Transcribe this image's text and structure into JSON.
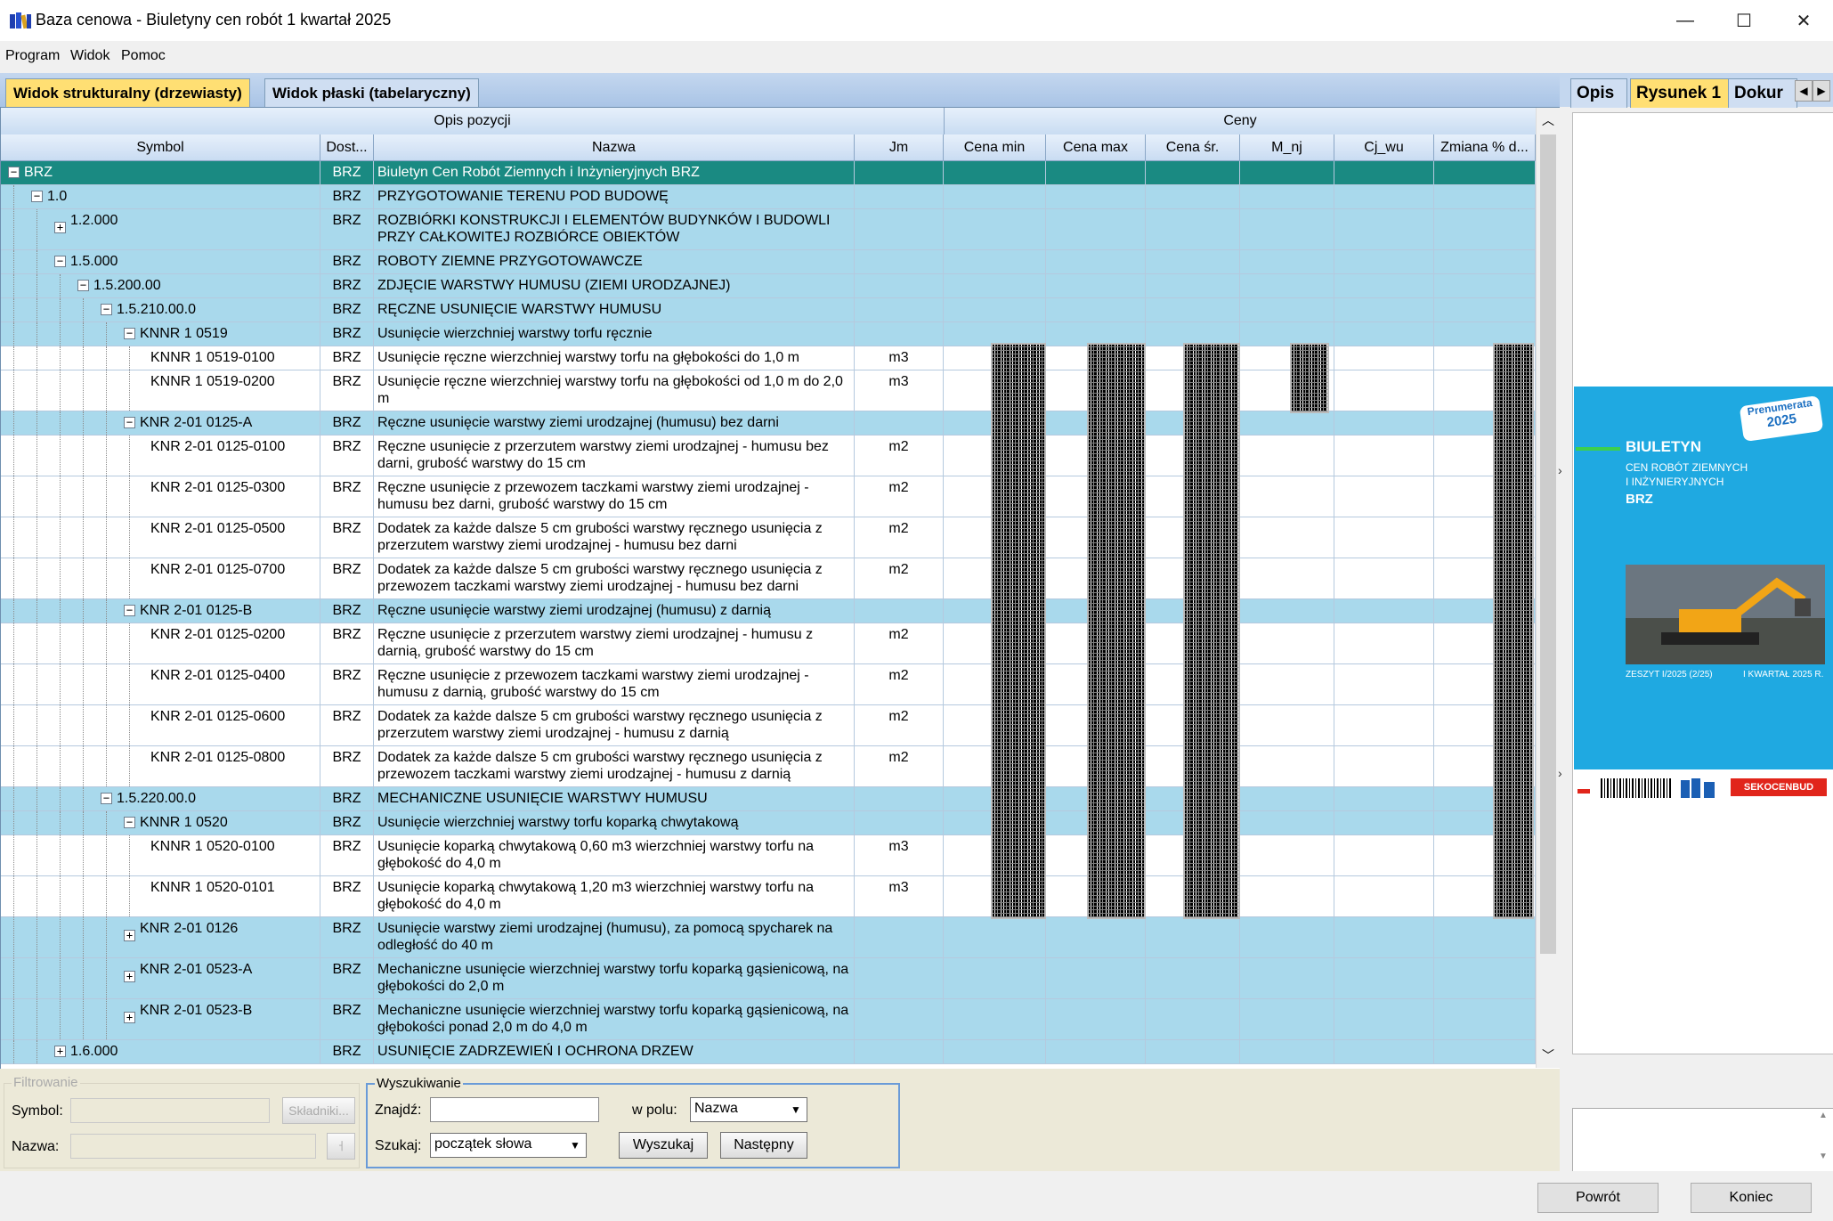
{
  "window": {
    "title": "Baza cenowa - Biuletyny cen robót 1 kwartał 2025",
    "minimize": "—",
    "maximize": "☐",
    "close": "✕"
  },
  "menu": [
    "Program",
    "Widok",
    "Pomoc"
  ],
  "tabs": [
    "Widok strukturalny (drzewiasty)",
    "Widok płaski (tabelaryczny)"
  ],
  "bands": {
    "left": "Opis pozycji",
    "right": "Ceny"
  },
  "columns": [
    "Symbol",
    "Dost...",
    "Nazwa",
    "Jm",
    "Cena min",
    "Cena max",
    "Cena śr.",
    "M_nj",
    "Cj_wu",
    "Zmiana % d..."
  ],
  "rows": [
    {
      "symbol": "BRZ",
      "dost": "BRZ",
      "nazwa": "Biuletyn Cen Robót Ziemnych i Inżynieryjnych BRZ",
      "jm": "",
      "level": 0,
      "type": "sel",
      "exp": "−",
      "h": 27
    },
    {
      "symbol": "1.0",
      "dost": "BRZ",
      "nazwa": "PRZYGOTOWANIE TERENU POD BUDOWĘ",
      "jm": "",
      "level": 1,
      "type": "group",
      "exp": "−",
      "h": 27
    },
    {
      "symbol": "1.2.000",
      "dost": "BRZ",
      "nazwa": "ROZBIÓRKI KONSTRUKCJI I ELEMENTÓW BUDYNKÓW I BUDOWLI PRZY CAŁKOWITEJ ROZBIÓRCE OBIEKTÓW",
      "jm": "",
      "level": 2,
      "type": "group",
      "exp": "+",
      "h": 46
    },
    {
      "symbol": "1.5.000",
      "dost": "BRZ",
      "nazwa": "ROBOTY ZIEMNE PRZYGOTOWAWCZE",
      "jm": "",
      "level": 2,
      "type": "group",
      "exp": "−",
      "h": 27
    },
    {
      "symbol": "1.5.200.00",
      "dost": "BRZ",
      "nazwa": "ZDJĘCIE WARSTWY HUMUSU (ZIEMI URODZAJNEJ)",
      "jm": "",
      "level": 3,
      "type": "group",
      "exp": "−",
      "h": 27
    },
    {
      "symbol": "1.5.210.00.0",
      "dost": "BRZ",
      "nazwa": "RĘCZNE USUNIĘCIE WARSTWY HUMUSU",
      "jm": "",
      "level": 4,
      "type": "group",
      "exp": "−",
      "h": 27
    },
    {
      "symbol": "KNNR 1 0519",
      "dost": "BRZ",
      "nazwa": "Usunięcie wierzchniej warstwy torfu ręcznie",
      "jm": "",
      "level": 5,
      "type": "group",
      "exp": "−",
      "h": 27
    },
    {
      "symbol": "KNNR 1 0519-0100",
      "dost": "BRZ",
      "nazwa": "Usunięcie ręczne wierzchniej warstwy torfu na głębokości do 1,0 m",
      "jm": "m3",
      "level": 6,
      "type": "leaf",
      "exp": "",
      "h": 27
    },
    {
      "symbol": "KNNR 1 0519-0200",
      "dost": "BRZ",
      "nazwa": "Usunięcie ręczne wierzchniej warstwy torfu na głębokości od 1,0 m do 2,0 m",
      "jm": "m3",
      "level": 6,
      "type": "leaf",
      "exp": "",
      "h": 46
    },
    {
      "symbol": "KNR 2-01 0125-A",
      "dost": "BRZ",
      "nazwa": "Ręczne usunięcie warstwy ziemi urodzajnej (humusu) bez darni",
      "jm": "",
      "level": 5,
      "type": "group",
      "exp": "−",
      "h": 27
    },
    {
      "symbol": "KNR 2-01 0125-0100",
      "dost": "BRZ",
      "nazwa": "Ręczne usunięcie z przerzutem warstwy ziemi urodzajnej - humusu bez darni, grubość warstwy do 15 cm",
      "jm": "m2",
      "level": 6,
      "type": "leaf",
      "exp": "",
      "h": 46
    },
    {
      "symbol": "KNR 2-01 0125-0300",
      "dost": "BRZ",
      "nazwa": "Ręczne usunięcie z przewozem taczkami warstwy ziemi urodzajnej - humusu bez darni, grubość warstwy do 15 cm",
      "jm": "m2",
      "level": 6,
      "type": "leaf",
      "exp": "",
      "h": 46
    },
    {
      "symbol": "KNR 2-01 0125-0500",
      "dost": "BRZ",
      "nazwa": "Dodatek za każde dalsze 5 cm grubości warstwy ręcznego usunięcia z przerzutem warstwy ziemi urodzajnej - humusu bez darni",
      "jm": "m2",
      "level": 6,
      "type": "leaf",
      "exp": "",
      "h": 46
    },
    {
      "symbol": "KNR 2-01 0125-0700",
      "dost": "BRZ",
      "nazwa": "Dodatek za każde dalsze 5 cm grubości warstwy ręcznego usunięcia z przewozem taczkami warstwy ziemi urodzajnej - humusu bez darni",
      "jm": "m2",
      "level": 6,
      "type": "leaf",
      "exp": "",
      "h": 46
    },
    {
      "symbol": "KNR 2-01 0125-B",
      "dost": "BRZ",
      "nazwa": "Ręczne usunięcie warstwy ziemi urodzajnej (humusu) z darnią",
      "jm": "",
      "level": 5,
      "type": "group",
      "exp": "−",
      "h": 27
    },
    {
      "symbol": "KNR 2-01 0125-0200",
      "dost": "BRZ",
      "nazwa": "Ręczne usunięcie z przerzutem warstwy ziemi urodzajnej - humusu z darnią, grubość warstwy do 15 cm",
      "jm": "m2",
      "level": 6,
      "type": "leaf",
      "exp": "",
      "h": 46
    },
    {
      "symbol": "KNR 2-01 0125-0400",
      "dost": "BRZ",
      "nazwa": "Ręczne usunięcie z przewozem taczkami warstwy ziemi urodzajnej - humusu z darnią, grubość warstwy do 15 cm",
      "jm": "m2",
      "level": 6,
      "type": "leaf",
      "exp": "",
      "h": 46
    },
    {
      "symbol": "KNR 2-01 0125-0600",
      "dost": "BRZ",
      "nazwa": "Dodatek za każde dalsze 5 cm grubości warstwy ręcznego usunięcia z przerzutem warstwy ziemi urodzajnej - humusu z darnią",
      "jm": "m2",
      "level": 6,
      "type": "leaf",
      "exp": "",
      "h": 46
    },
    {
      "symbol": "KNR 2-01 0125-0800",
      "dost": "BRZ",
      "nazwa": "Dodatek za każde dalsze 5 cm grubości warstwy ręcznego usunięcia z przewozem taczkami warstwy ziemi urodzajnej - humusu z darnią",
      "jm": "m2",
      "level": 6,
      "type": "leaf",
      "exp": "",
      "h": 46
    },
    {
      "symbol": "1.5.220.00.0",
      "dost": "BRZ",
      "nazwa": "MECHANICZNE USUNIĘCIE WARSTWY HUMUSU",
      "jm": "",
      "level": 4,
      "type": "group",
      "exp": "−",
      "h": 27
    },
    {
      "symbol": "KNNR 1 0520",
      "dost": "BRZ",
      "nazwa": "Usunięcie wierzchniej warstwy torfu koparką chwytakową",
      "jm": "",
      "level": 5,
      "type": "group",
      "exp": "−",
      "h": 27
    },
    {
      "symbol": "KNNR 1 0520-0100",
      "dost": "BRZ",
      "nazwa": "Usunięcie koparką chwytakową 0,60 m3 wierzchniej warstwy torfu na głębokość do 4,0 m",
      "jm": "m3",
      "level": 6,
      "type": "leaf",
      "exp": "",
      "h": 46
    },
    {
      "symbol": "KNNR 1 0520-0101",
      "dost": "BRZ",
      "nazwa": "Usunięcie koparką chwytakową 1,20 m3 wierzchniej warstwy torfu na głębokość do 4,0 m",
      "jm": "m3",
      "level": 6,
      "type": "leaf",
      "exp": "",
      "h": 46
    },
    {
      "symbol": "KNR 2-01 0126",
      "dost": "BRZ",
      "nazwa": "Usunięcie warstwy ziemi urodzajnej (humusu), za pomocą spycharek na odległość do 40 m",
      "jm": "",
      "level": 5,
      "type": "group",
      "exp": "+",
      "h": 46
    },
    {
      "symbol": "KNR 2-01 0523-A",
      "dost": "BRZ",
      "nazwa": "Mechaniczne usunięcie wierzchniej warstwy torfu koparką gąsienicową, na głębokości do 2,0 m",
      "jm": "",
      "level": 5,
      "type": "group",
      "exp": "+",
      "h": 46
    },
    {
      "symbol": "KNR 2-01 0523-B",
      "dost": "BRZ",
      "nazwa": "Mechaniczne usunięcie wierzchniej warstwy torfu koparką gąsienicową, na głębokości ponad 2,0 m do 4,0 m",
      "jm": "",
      "level": 5,
      "type": "group",
      "exp": "+",
      "h": 46
    },
    {
      "symbol": "1.6.000",
      "dost": "BRZ",
      "nazwa": "USUNIĘCIE ZADRZEWIEŃ I OCHRONA DRZEW",
      "jm": "",
      "level": 2,
      "type": "group",
      "exp": "+",
      "h": 27
    }
  ],
  "filter": {
    "legend": "Filtrowanie",
    "symbol_label": "Symbol:",
    "nazwa_label": "Nazwa:",
    "skladniki": "Składniki...",
    "small_btn": "ㅓ"
  },
  "search": {
    "legend": "Wyszukiwanie",
    "znajdz_label": "Znajdź:",
    "znajdz_value": "",
    "wpolu_label": "w polu:",
    "wpolu_value": "Nazwa",
    "szukaj_label": "Szukaj:",
    "szukaj_value": "początek słowa",
    "search_btn": "Wyszukaj",
    "next_btn": "Następny"
  },
  "right_tabs": [
    "Opis",
    "Rysunek 1",
    "Dokur"
  ],
  "cover": {
    "badge_top": "Prenumerata",
    "badge_year": "2025",
    "title": "BIULETYN",
    "subtitle1": "CEN ROBÓT ZIEMNYCH",
    "subtitle2": "I INŻYNIERYJNYCH",
    "code": "BRZ",
    "issue": "ZESZYT I/2025 (2/25)",
    "quarter": "I KWARTAŁ 2025 R.",
    "publisher": "SEKOCENBUD"
  },
  "footer": {
    "back": "Powrót",
    "end": "Koniec"
  },
  "colors": {
    "selected_row": "#1a8a82",
    "group_row": "#a9d9ec",
    "active_tab": "#ffdf73",
    "cover": "#1fa9e1"
  }
}
